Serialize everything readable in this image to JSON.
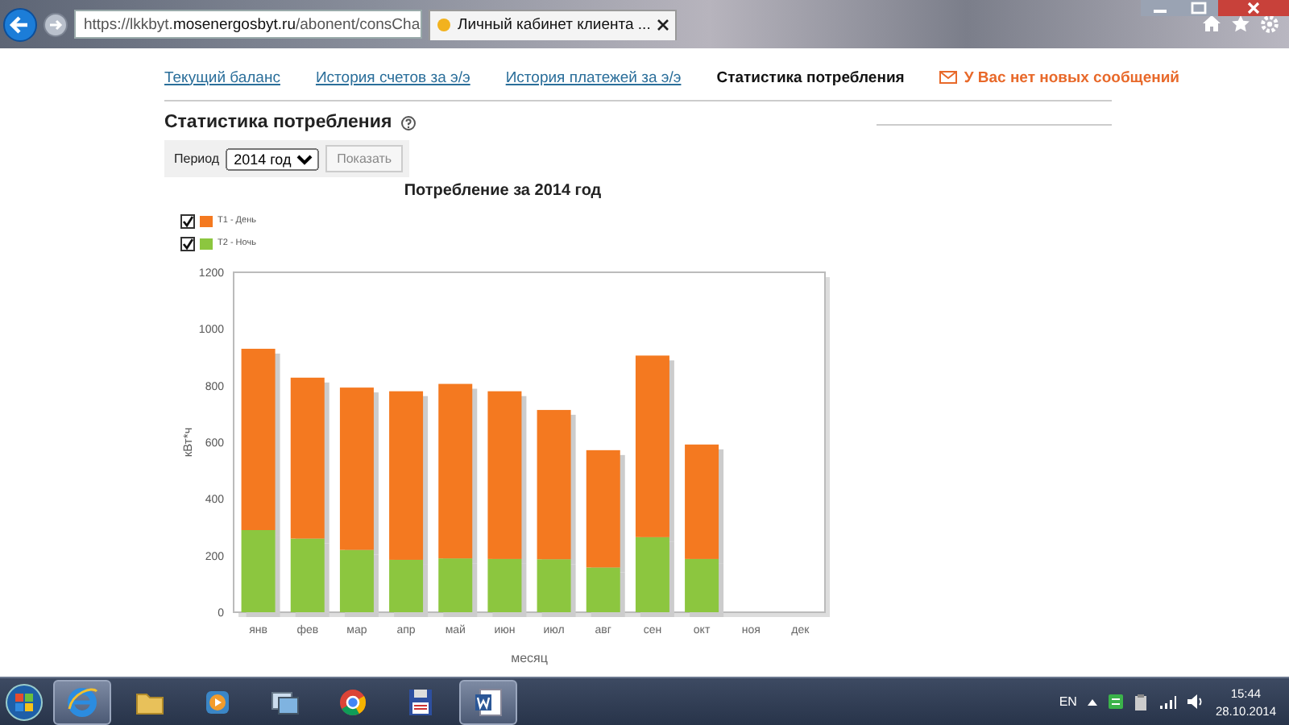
{
  "browser": {
    "address": "https://lkkbyt.**mosenergosbyt.ru**/abonent/consCha",
    "tab": {
      "title": "Личный кабинет клиента ...",
      "selected": true
    }
  },
  "nav": {
    "items": [
      {
        "label": "Текущий баланс",
        "selected": false
      },
      {
        "label": "История счетов за э/э",
        "selected": false
      },
      {
        "label": "История платежей за э/э",
        "selected": false
      },
      {
        "label": "Статистика потребления",
        "selected": true
      }
    ],
    "messages": "У Вас нет новых сообщений"
  },
  "panel": {
    "heading": "Статистика потребления",
    "period": {
      "label": "Период",
      "value": "2014 год",
      "button": "Показать"
    }
  },
  "chart_data": {
    "type": "bar",
    "stacked": true,
    "title": "Потребление за 2014 год",
    "xlabel": "месяц",
    "ylabel": "кВт*ч",
    "categories": [
      "янв",
      "фев",
      "мар",
      "апр",
      "май",
      "июн",
      "июл",
      "авг",
      "сен",
      "окт",
      "ноя",
      "дек"
    ],
    "ylim": [
      0,
      1200
    ],
    "yticks": [
      0,
      200,
      400,
      600,
      800,
      1000,
      1200
    ],
    "series": [
      {
        "name": "T1 - День",
        "color": "#f47920",
        "values": [
          640,
          568,
          573,
          595,
          616,
          592,
          527,
          414,
          641,
          404,
          null,
          null
        ]
      },
      {
        "name": "T2 - Ночь",
        "color": "#8cc63f",
        "values": [
          290,
          260,
          220,
          185,
          190,
          188,
          187,
          158,
          265,
          188,
          null,
          null
        ]
      }
    ]
  },
  "legend": [
    {
      "checked": true
    },
    {
      "checked": true
    }
  ],
  "taskbar": {
    "apps": [
      {
        "kind": "ie",
        "active": true
      },
      {
        "kind": "folder",
        "active": false
      },
      {
        "kind": "media",
        "active": false
      },
      {
        "kind": "photos",
        "active": false
      },
      {
        "kind": "chrome",
        "active": false
      },
      {
        "kind": "disk",
        "active": false
      },
      {
        "kind": "word",
        "active": true
      }
    ],
    "language": "EN",
    "time": "15:44",
    "date": "28.10.2014"
  }
}
